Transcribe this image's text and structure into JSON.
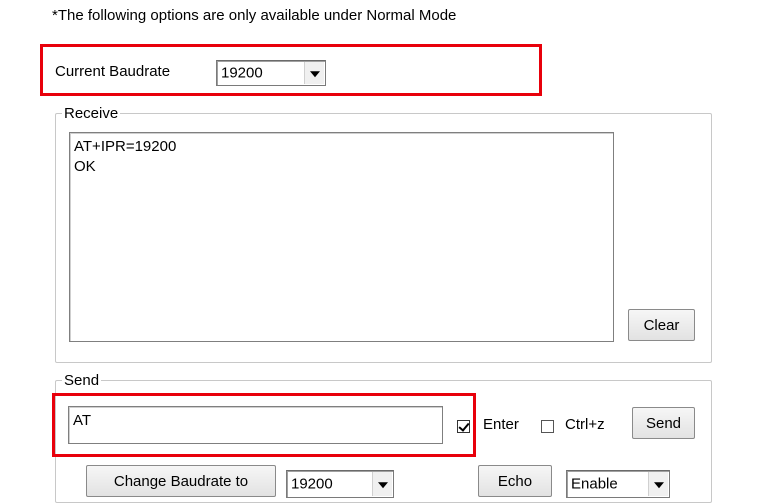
{
  "note": "*The following options are only available under Normal Mode",
  "current_baudrate": {
    "label": "Current Baudrate",
    "value": "19200"
  },
  "receive": {
    "legend": "Receive",
    "lines": [
      "AT+IPR=19200",
      "OK"
    ],
    "clear_label": "Clear"
  },
  "send": {
    "legend": "Send",
    "input_value": "AT",
    "enter_label": "Enter",
    "enter_checked": true,
    "ctrlz_label": "Ctrl+z",
    "ctrlz_checked": false,
    "send_label": "Send",
    "change_baudrate_label": "Change Baudrate to",
    "change_baudrate_value": "19200",
    "echo_label": "Echo",
    "echo_value": "Enable"
  },
  "colors": {
    "highlight": "#e8000b"
  }
}
